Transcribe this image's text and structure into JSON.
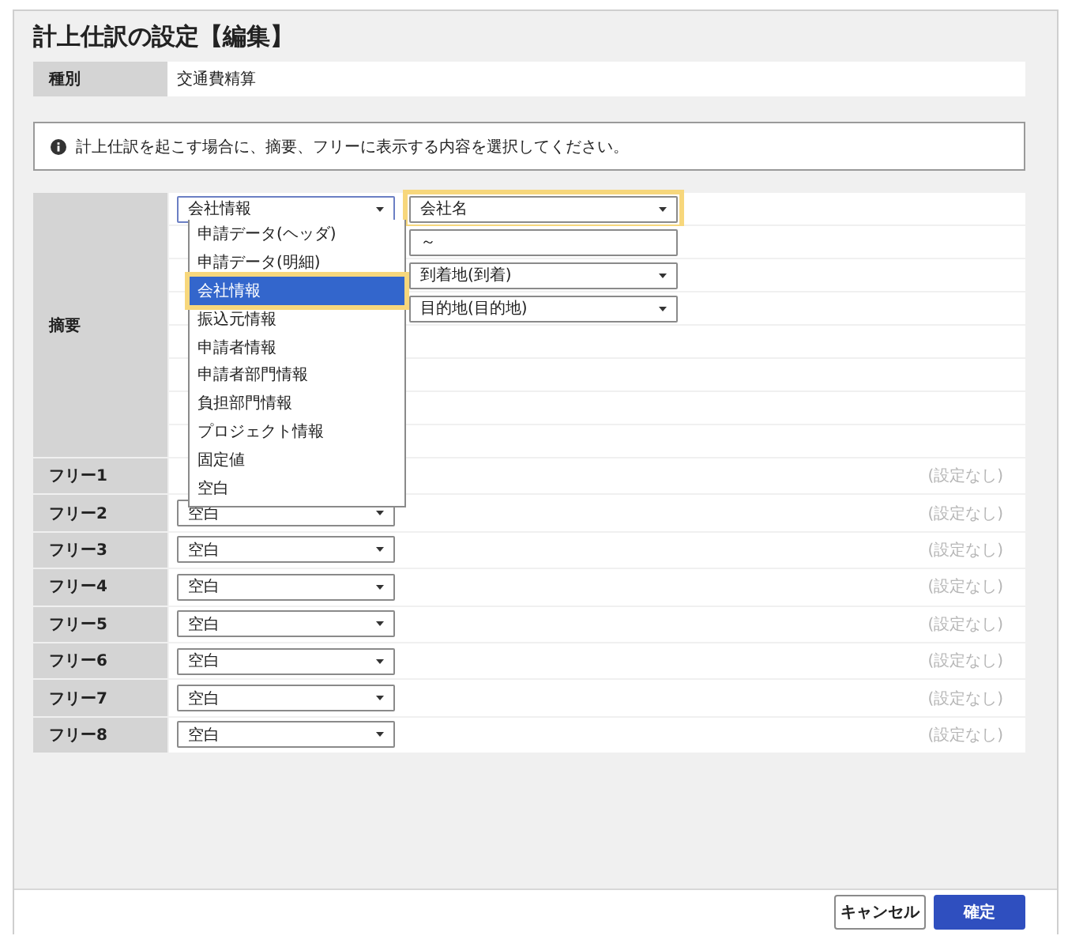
{
  "title": "計上仕訳の設定【編集】",
  "type_row": {
    "label": "種別",
    "value": "交通費精算"
  },
  "info": "計上仕訳を起こす場合に、摘要、フリーに表示する内容を選択してください。",
  "summary": {
    "label": "摘要",
    "rows": [
      {
        "left": {
          "kind": "select",
          "value": "会社情報",
          "open": true
        },
        "right": {
          "kind": "select",
          "value": "会社名",
          "highlighted": true
        }
      },
      {
        "right": {
          "kind": "input",
          "value": "～"
        }
      },
      {
        "right": {
          "kind": "select",
          "value": "到着地(到着)"
        }
      },
      {
        "right": {
          "kind": "select",
          "value": "目的地(目的地)"
        }
      },
      {},
      {},
      {},
      {}
    ]
  },
  "dropdown": {
    "options": [
      {
        "label": "申請データ(ヘッダ)",
        "selected": false,
        "highlighted": false
      },
      {
        "label": "申請データ(明細)",
        "selected": false,
        "highlighted": false
      },
      {
        "label": "会社情報",
        "selected": true,
        "highlighted": true
      },
      {
        "label": "振込元情報",
        "selected": false,
        "highlighted": false
      },
      {
        "label": "申請者情報",
        "selected": false,
        "highlighted": false
      },
      {
        "label": "申請者部門情報",
        "selected": false,
        "highlighted": false
      },
      {
        "label": "負担部門情報",
        "selected": false,
        "highlighted": false
      },
      {
        "label": "プロジェクト情報",
        "selected": false,
        "highlighted": false
      },
      {
        "label": "固定値",
        "selected": false,
        "highlighted": false
      },
      {
        "label": "空白",
        "selected": false,
        "highlighted": false
      }
    ]
  },
  "free_rows": [
    {
      "label": "フリー1",
      "note": "(設定なし)"
    },
    {
      "label": "フリー2",
      "select": "空白",
      "note": "(設定なし)"
    },
    {
      "label": "フリー3",
      "select": "空白",
      "note": "(設定なし)"
    },
    {
      "label": "フリー4",
      "select": "空白",
      "note": "(設定なし)"
    },
    {
      "label": "フリー5",
      "select": "空白",
      "note": "(設定なし)"
    },
    {
      "label": "フリー6",
      "select": "空白",
      "note": "(設定なし)"
    },
    {
      "label": "フリー7",
      "select": "空白",
      "note": "(設定なし)"
    },
    {
      "label": "フリー8",
      "select": "空白",
      "note": "(設定なし)"
    }
  ],
  "buttons": [
    {
      "label": "キャンセル",
      "kind": "secondary"
    },
    {
      "label": "確定",
      "kind": "primary"
    }
  ]
}
